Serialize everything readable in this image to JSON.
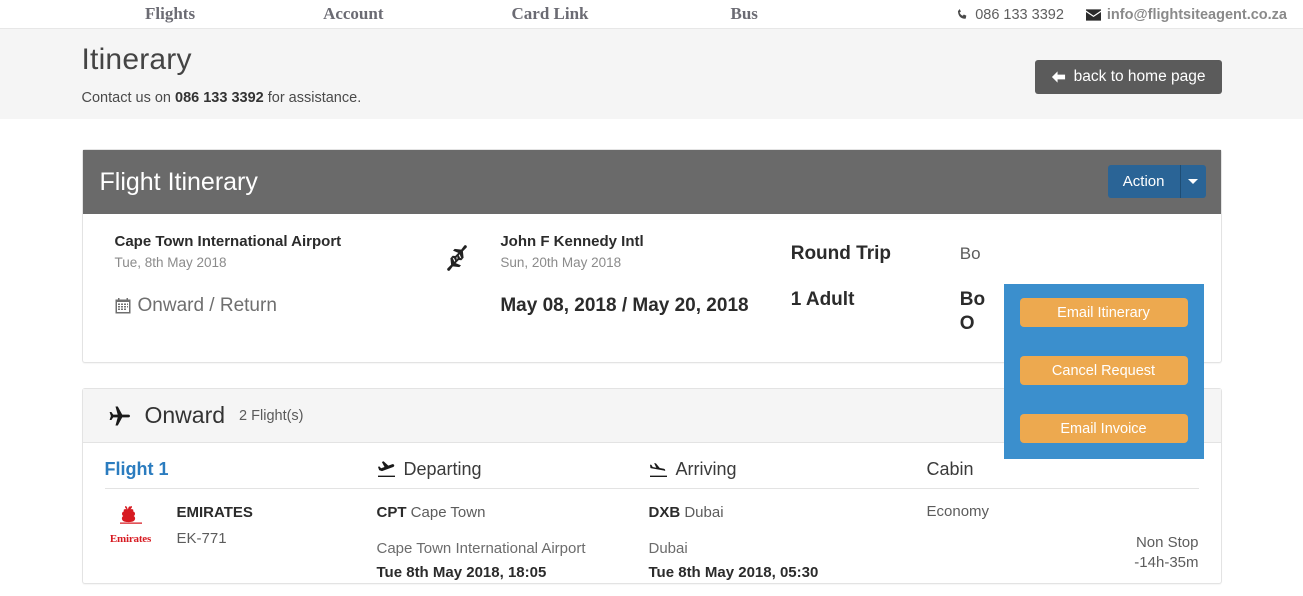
{
  "topnav": {
    "links": [
      {
        "label": "Flights"
      },
      {
        "label": "Account"
      },
      {
        "label": "Card Link"
      },
      {
        "label": "Bus"
      }
    ],
    "phone": "086 133 3392",
    "email": "info@flightsiteagent.co.za",
    "phone_icon": "phone-icon",
    "email_icon": "envelope-icon"
  },
  "heading": {
    "title": "Itinerary",
    "assist_prefix": "Contact us on ",
    "assist_phone": "086 133 3392",
    "assist_suffix": " for assistance.",
    "home_button": "back to home page",
    "home_button_icon": "arrow-left-icon"
  },
  "itinerary": {
    "panel_title": "Flight Itinerary",
    "action_button": "Action",
    "caret_icon": "chevron-down-icon",
    "dropdown": {
      "items": [
        {
          "label": "Email Itinerary"
        },
        {
          "label": "Cancel Request"
        },
        {
          "label": "Email Invoice"
        }
      ]
    },
    "summary": {
      "origin_airport": "Cape Town International Airport",
      "origin_date": "Tue, 8th May 2018",
      "trip_type_label": "Onward / Return",
      "trip_type_icon": "calendar-icon",
      "route_icon": "planes-exchange-icon",
      "dest_airport": "John F Kennedy Intl",
      "dest_date": "Sun, 20th May 2018",
      "dates": "May 08, 2018 / May 20, 2018",
      "trip_kind": "Round Trip",
      "pax": "1 Adult",
      "booking_label_clipped": "Bo",
      "booking_value_clipped_line1": "Bo",
      "booking_value_clipped_line2": "O"
    }
  },
  "onward": {
    "title": "Onward",
    "plane_icon": "plane-icon",
    "count": "2 Flight(s)",
    "headers": {
      "flight": "Flight 1",
      "departing": "Departing",
      "departing_icon": "plane-departure-icon",
      "arriving": "Arriving",
      "arriving_icon": "plane-arrival-icon",
      "cabin": "Cabin"
    },
    "rows": [
      {
        "airline": "EMIRATES",
        "airline_logo": "emirates-logo",
        "airline_logo_text": "Emirates",
        "flight_number": "EK-771",
        "dep_code": "CPT",
        "dep_city": "Cape Town",
        "dep_airport": "Cape Town International Airport",
        "dep_time": "Tue 8th May 2018, 18:05",
        "arr_code": "DXB",
        "arr_city": "Dubai",
        "arr_airport": "Dubai",
        "arr_time": "Tue 8th May 2018, 05:30",
        "cabin": "Economy",
        "stops": "Non Stop",
        "duration": "-14h-35m"
      }
    ]
  },
  "colors": {
    "nav_text": "#6b6b73",
    "band": "#f5f5f5",
    "panel_head": "#6a6a6a",
    "action_blue": "#2a6496",
    "dropdown_blue": "#3b8fcd",
    "dropdown_btn_orange": "#eda94f",
    "link_blue": "#2b7cbf",
    "home_btn_gray": "#5b5b5b",
    "emirates_red": "#d71a21"
  }
}
